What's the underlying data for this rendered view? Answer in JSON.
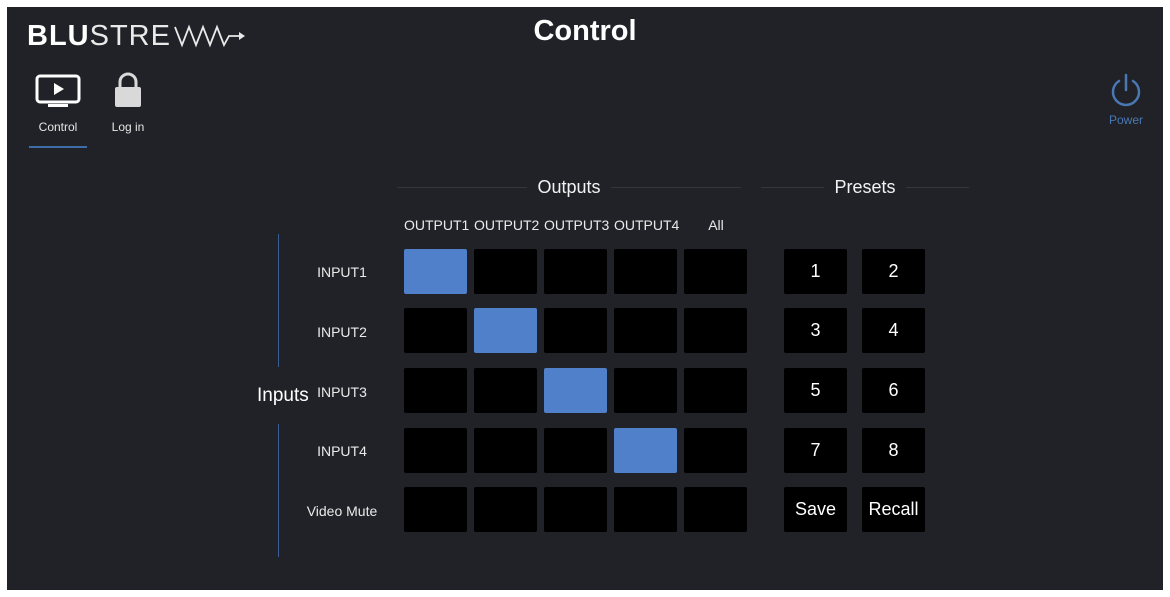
{
  "header": {
    "logo_bold": "BLU",
    "logo_thin": "STRE",
    "title": "Control"
  },
  "nav": [
    {
      "label": "Control",
      "icon": "monitor-play-icon",
      "active": true
    },
    {
      "label": "Log in",
      "icon": "lock-icon",
      "active": false
    }
  ],
  "power": {
    "label": "Power",
    "icon": "power-icon",
    "color": "#4a78b4"
  },
  "matrix": {
    "section_title": "Outputs",
    "axis_label": "Inputs",
    "columns": [
      "OUTPUT1",
      "OUTPUT2",
      "OUTPUT3",
      "OUTPUT4",
      "All"
    ],
    "rows": [
      "INPUT1",
      "INPUT2",
      "INPUT3",
      "INPUT4",
      "Video Mute"
    ],
    "active": [
      [
        0,
        0
      ],
      [
        1,
        1
      ],
      [
        2,
        2
      ],
      [
        3,
        3
      ]
    ],
    "active_color": "#4f80c9"
  },
  "presets": {
    "section_title": "Presets",
    "buttons": [
      "1",
      "2",
      "3",
      "4",
      "5",
      "6",
      "7",
      "8",
      "Save",
      "Recall"
    ]
  }
}
